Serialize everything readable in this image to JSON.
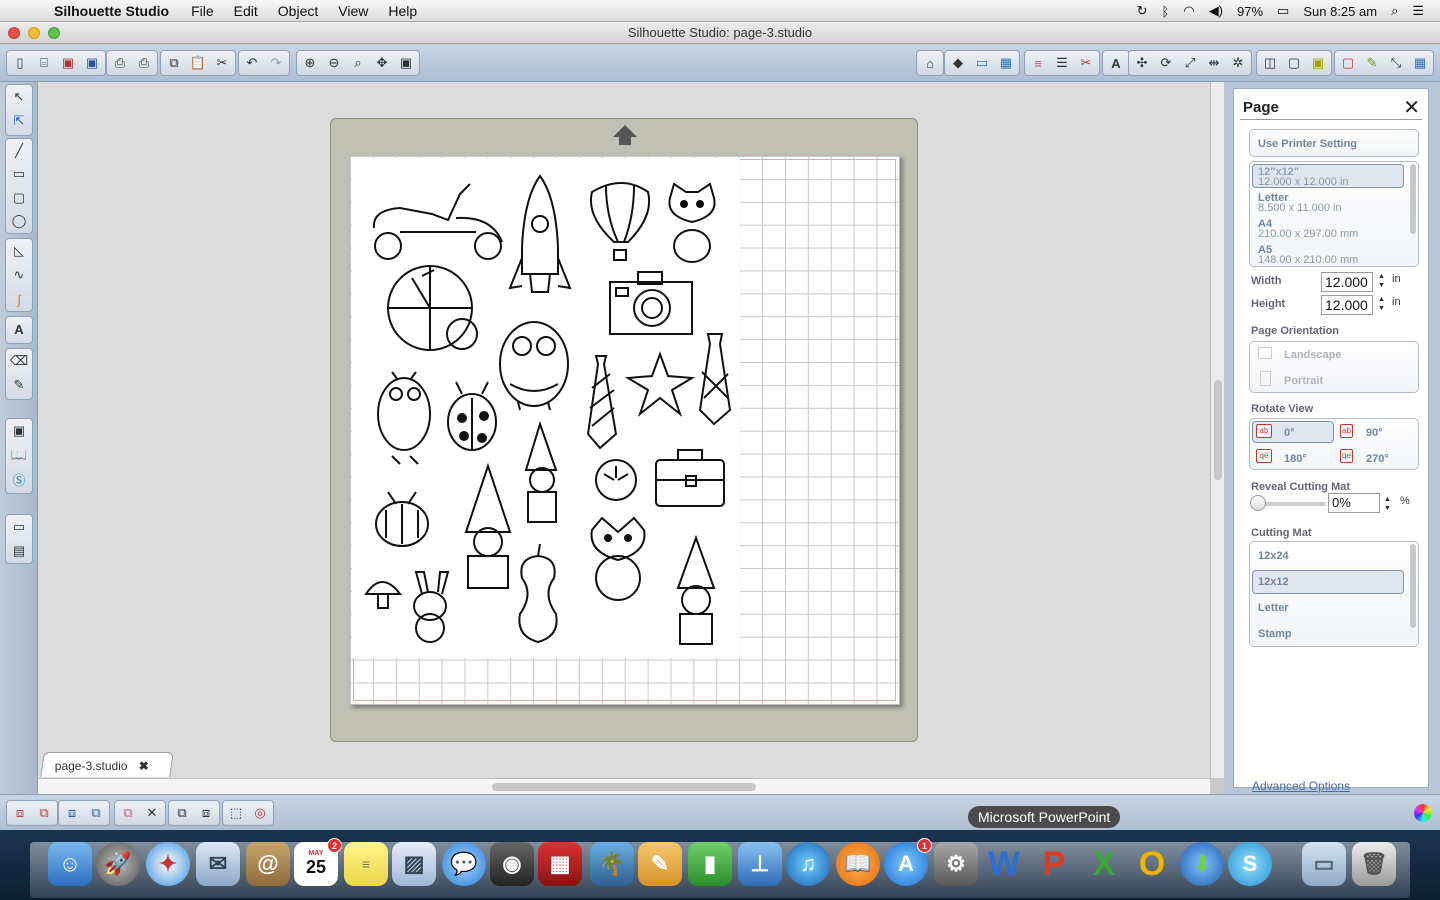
{
  "menubar": {
    "app_name": "Silhouette Studio",
    "menus": [
      "File",
      "Edit",
      "Object",
      "View",
      "Help"
    ],
    "battery": "97%",
    "clock": "Sun 8:25 am"
  },
  "window": {
    "title": "Silhouette Studio: page-3.studio"
  },
  "document_tab": {
    "label": "page-3.studio"
  },
  "panel": {
    "title": "Page",
    "use_printer_setting": "Use Printer Setting",
    "page_sizes": [
      {
        "name": "12\"x12\"",
        "dims": "12.000 x 12.000 in"
      },
      {
        "name": "Letter",
        "dims": "8.500 x 11.000 in"
      },
      {
        "name": "A4",
        "dims": "210.00 x 297.00 mm"
      },
      {
        "name": "A5",
        "dims": "148.00 x 210.00 mm"
      }
    ],
    "width_label": "Width",
    "width_value": "12.000",
    "height_label": "Height",
    "height_value": "12.000",
    "unit": "in",
    "orientation_label": "Page Orientation",
    "orientation_options": [
      "Landscape",
      "Portrait"
    ],
    "rotate_label": "Rotate View",
    "rotate_options": [
      "0°",
      "90°",
      "180°",
      "270°"
    ],
    "reveal_label": "Reveal Cutting Mat",
    "reveal_value": "0%",
    "percent": "%",
    "cutting_mat_label": "Cutting Mat",
    "cutting_mats": [
      "12x24",
      "12x12",
      "Letter",
      "Stamp"
    ],
    "advanced": "Advanced Options"
  },
  "tooltip": "Microsoft PowerPoint",
  "dock": {
    "calendar_date": "25",
    "calendar_month": "MAY",
    "calendar_badge": "2",
    "appstore_badge": "1",
    "apps": [
      "Finder",
      "Launchpad",
      "Safari",
      "Mail",
      "Contacts",
      "Calendar",
      "Stickies",
      "Preview",
      "Messages",
      "FaceTime",
      "Photo Booth",
      "iPhoto",
      "Pages",
      "Numbers",
      "Keynote",
      "iTunes",
      "iBooks",
      "App Store",
      "System Preferences",
      "Word",
      "PowerPoint",
      "Excel",
      "Outlook",
      "Downloader",
      "Silhouette Studio",
      "Documents",
      "Trash"
    ]
  }
}
